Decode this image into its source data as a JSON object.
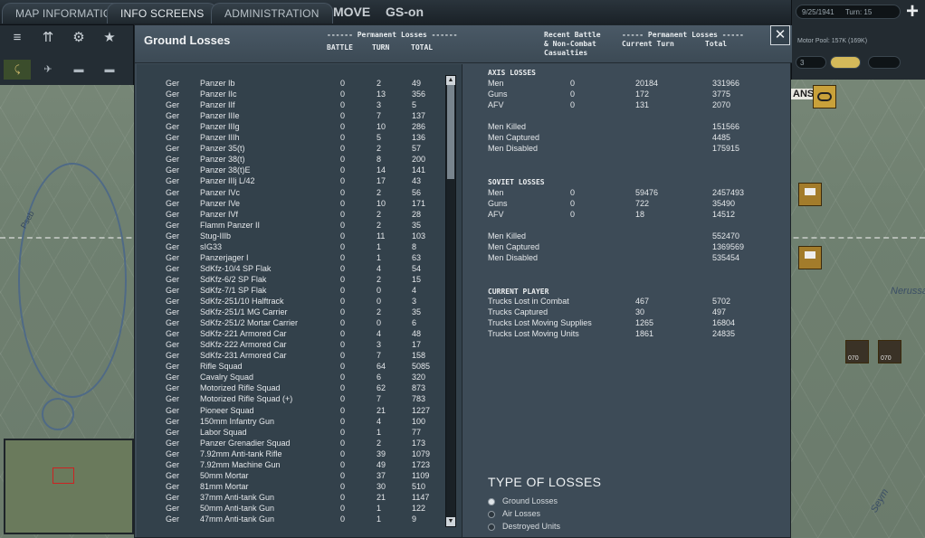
{
  "top_tabs": [
    "MAP INFORMATION",
    "INFO SCREENS",
    "ADMINISTRATION"
  ],
  "mode": {
    "label": "MOVE",
    "group": "GS-on"
  },
  "status": {
    "date": "9/25/1941",
    "turn": "Turn: 15",
    "motor_pool": "Motor Pool: 157K (169K)",
    "small_num": "3"
  },
  "map_labels": {
    "town": "ANS",
    "river": "Nerussa",
    "river2": "Seym",
    "unit_code": "070",
    "river_left": "Pseb"
  },
  "panel": {
    "title": "Ground Losses",
    "close_label": "✕",
    "headers": {
      "perm_title": "------ Permanent Losses ------",
      "battle": "BATTLE",
      "turn": "TURN",
      "total": "TOTAL",
      "recent_line1": "Recent Battle",
      "recent_line2": "& Non-Combat",
      "recent_line3": "Casualties",
      "perm2_title": "----- Permanent Losses -----",
      "current_turn": "Current Turn",
      "total2": "Total"
    }
  },
  "losses_table": [
    [
      "Ger",
      "Panzer Ib",
      "0",
      "2",
      "49"
    ],
    [
      "Ger",
      "Panzer IIc",
      "0",
      "13",
      "356"
    ],
    [
      "Ger",
      "Panzer IIf",
      "0",
      "3",
      "5"
    ],
    [
      "Ger",
      "Panzer IIIe",
      "0",
      "7",
      "137"
    ],
    [
      "Ger",
      "Panzer IIIg",
      "0",
      "10",
      "286"
    ],
    [
      "Ger",
      "Panzer IIIh",
      "0",
      "5",
      "136"
    ],
    [
      "Ger",
      "Panzer 35(t)",
      "0",
      "2",
      "57"
    ],
    [
      "Ger",
      "Panzer 38(t)",
      "0",
      "8",
      "200"
    ],
    [
      "Ger",
      "Panzer 38(t)E",
      "0",
      "14",
      "141"
    ],
    [
      "Ger",
      "Panzer IIIj L/42",
      "0",
      "17",
      "43"
    ],
    [
      "Ger",
      "Panzer IVc",
      "0",
      "2",
      "56"
    ],
    [
      "Ger",
      "Panzer IVe",
      "0",
      "10",
      "171"
    ],
    [
      "Ger",
      "Panzer IVf",
      "0",
      "2",
      "28"
    ],
    [
      "Ger",
      "Flamm Panzer II",
      "0",
      "2",
      "35"
    ],
    [
      "Ger",
      "Stug-IIIb",
      "0",
      "11",
      "103"
    ],
    [
      "Ger",
      "sIG33",
      "0",
      "1",
      "8"
    ],
    [
      "Ger",
      "Panzerjager I",
      "0",
      "1",
      "63"
    ],
    [
      "Ger",
      "SdKfz-10/4 SP Flak",
      "0",
      "4",
      "54"
    ],
    [
      "Ger",
      "SdKfz-6/2 SP Flak",
      "0",
      "2",
      "15"
    ],
    [
      "Ger",
      "SdKfz-7/1 SP Flak",
      "0",
      "0",
      "4"
    ],
    [
      "Ger",
      "SdKfz-251/10 Halftrack",
      "0",
      "0",
      "3"
    ],
    [
      "Ger",
      "SdKfz-251/1 MG Carrier",
      "0",
      "2",
      "35"
    ],
    [
      "Ger",
      "SdKfz-251/2 Mortar Carrier",
      "0",
      "0",
      "6"
    ],
    [
      "Ger",
      "SdKfz-221 Armored Car",
      "0",
      "4",
      "48"
    ],
    [
      "Ger",
      "SdKfz-222 Armored Car",
      "0",
      "3",
      "17"
    ],
    [
      "Ger",
      "SdKfz-231 Armored Car",
      "0",
      "7",
      "158"
    ],
    [
      "Ger",
      "Rifle Squad",
      "0",
      "64",
      "5085"
    ],
    [
      "Ger",
      "Cavalry Squad",
      "0",
      "6",
      "320"
    ],
    [
      "Ger",
      "Motorized Rifle Squad",
      "0",
      "62",
      "873"
    ],
    [
      "Ger",
      "Motorized Rifle Squad (+)",
      "0",
      "7",
      "783"
    ],
    [
      "Ger",
      "Pioneer Squad",
      "0",
      "21",
      "1227"
    ],
    [
      "Ger",
      "150mm Infantry Gun",
      "0",
      "4",
      "100"
    ],
    [
      "Ger",
      "Labor Squad",
      "0",
      "1",
      "77"
    ],
    [
      "Ger",
      "Panzer Grenadier Squad",
      "0",
      "2",
      "173"
    ],
    [
      "Ger",
      "7.92mm Anti-tank Rifle",
      "0",
      "39",
      "1079"
    ],
    [
      "Ger",
      "7.92mm Machine Gun",
      "0",
      "49",
      "1723"
    ],
    [
      "Ger",
      "50mm Mortar",
      "0",
      "37",
      "1109"
    ],
    [
      "Ger",
      "81mm Mortar",
      "0",
      "30",
      "510"
    ],
    [
      "Ger",
      "37mm Anti-tank Gun",
      "0",
      "21",
      "1147"
    ],
    [
      "Ger",
      "50mm Anti-tank Gun",
      "0",
      "1",
      "122"
    ],
    [
      "Ger",
      "47mm Anti-tank Gun",
      "0",
      "1",
      "9"
    ]
  ],
  "axis": {
    "title": "AXIS LOSSES",
    "rows": [
      [
        "Men",
        "0",
        "20184",
        "331966"
      ],
      [
        "Guns",
        "0",
        "172",
        "3775"
      ],
      [
        "AFV",
        "0",
        "131",
        "2070"
      ]
    ],
    "sub": [
      [
        "Men Killed",
        "151566"
      ],
      [
        "Men Captured",
        "4485"
      ],
      [
        "Men Disabled",
        "175915"
      ]
    ]
  },
  "soviet": {
    "title": "SOVIET LOSSES",
    "rows": [
      [
        "Men",
        "0",
        "59476",
        "2457493"
      ],
      [
        "Guns",
        "0",
        "722",
        "35490"
      ],
      [
        "AFV",
        "0",
        "18",
        "14512"
      ]
    ],
    "sub": [
      [
        "Men Killed",
        "552470"
      ],
      [
        "Men Captured",
        "1369569"
      ],
      [
        "Men Disabled",
        "535454"
      ]
    ]
  },
  "player": {
    "title": "CURRENT PLAYER",
    "rows": [
      [
        "Trucks Lost in Combat",
        "467",
        "5702"
      ],
      [
        "Trucks Captured",
        "30",
        "497"
      ],
      [
        "Trucks Lost Moving Supplies",
        "1265",
        "16804"
      ],
      [
        "Trucks Lost Moving Units",
        "1861",
        "24835"
      ]
    ]
  },
  "type_of_losses": {
    "title": "TYPE OF LOSSES",
    "options": [
      "Ground Losses",
      "Air Losses",
      "Destroyed Units"
    ],
    "selected": "Ground Losses"
  }
}
